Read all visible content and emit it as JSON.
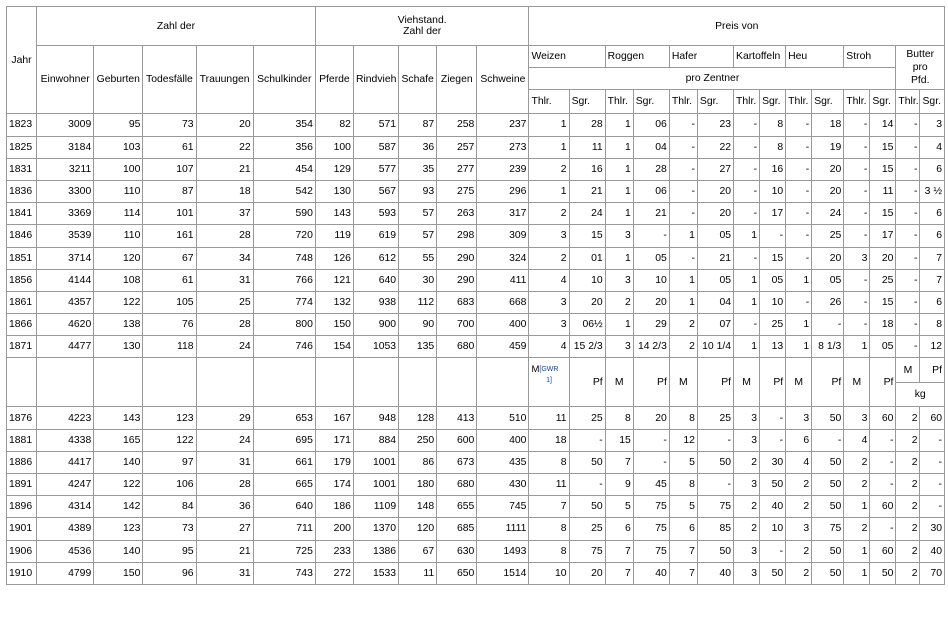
{
  "headers": {
    "jahr": "Jahr",
    "zahl_der": "Zahl der",
    "viehstand_line1": "Viehstand.",
    "viehstand_line2": "Zahl der",
    "preis_von": "Preis von",
    "pro_zentner": "pro Zentner",
    "butter_line1": "Butter",
    "butter_line2": "pro",
    "butter_line3": "Pfd.",
    "columns_population": [
      "Einwohner",
      "Geburten",
      "Todesfälle",
      "Trauungen",
      "Schulkinder"
    ],
    "columns_livestock": [
      "Pferde",
      "Rindvieh",
      "Schafe",
      "Ziegen",
      "Schweine"
    ],
    "goods": [
      "Weizen",
      "Roggen",
      "Hafer",
      "Kartoffeln",
      "Heu",
      "Stroh"
    ],
    "currency_old": [
      "Thlr.",
      "Sgr."
    ],
    "unit_kg": "kg"
  },
  "marker_row": {
    "m_label": "M",
    "m_sup": "[GWR",
    "m_sup_cont": "1]",
    "pf": "Pf",
    "m": "M"
  },
  "rows_old": [
    [
      "1823",
      "3009",
      "95",
      "73",
      "20",
      "354",
      "82",
      "571",
      "87",
      "258",
      "237",
      "1",
      "28",
      "1",
      "06",
      "-",
      "23",
      "-",
      "8",
      "-",
      "18",
      "-",
      "14",
      "-",
      "3"
    ],
    [
      "1825",
      "3184",
      "103",
      "61",
      "22",
      "356",
      "100",
      "587",
      "36",
      "257",
      "273",
      "1",
      "11",
      "1",
      "04",
      "-",
      "22",
      "-",
      "8",
      "-",
      "19",
      "-",
      "15",
      "-",
      "4"
    ],
    [
      "1831",
      "3211",
      "100",
      "107",
      "21",
      "454",
      "129",
      "577",
      "35",
      "277",
      "239",
      "2",
      "16",
      "1",
      "28",
      "-",
      "27",
      "-",
      "16",
      "-",
      "20",
      "-",
      "15",
      "-",
      "6"
    ],
    [
      "1836",
      "3300",
      "110",
      "87",
      "18",
      "542",
      "130",
      "567",
      "93",
      "275",
      "296",
      "1",
      "21",
      "1",
      "06",
      "-",
      "20",
      "-",
      "10",
      "-",
      "20",
      "-",
      "11",
      "-",
      "3 ½"
    ],
    [
      "1841",
      "3369",
      "114",
      "101",
      "37",
      "590",
      "143",
      "593",
      "57",
      "263",
      "317",
      "2",
      "24",
      "1",
      "21",
      "-",
      "20",
      "-",
      "17",
      "-",
      "24",
      "-",
      "15",
      "-",
      "6"
    ],
    [
      "1846",
      "3539",
      "110",
      "161",
      "28",
      "720",
      "119",
      "619",
      "57",
      "298",
      "309",
      "3",
      "15",
      "3",
      "-",
      "1",
      "05",
      "1",
      "-",
      "-",
      "25",
      "-",
      "17",
      "-",
      "6"
    ],
    [
      "1851",
      "3714",
      "120",
      "67",
      "34",
      "748",
      "126",
      "612",
      "55",
      "290",
      "324",
      "2",
      "01",
      "1",
      "05",
      "-",
      "21",
      "-",
      "15",
      "-",
      "20",
      "3",
      "20",
      "-",
      "7"
    ],
    [
      "1856",
      "4144",
      "108",
      "61",
      "31",
      "766",
      "121",
      "640",
      "30",
      "290",
      "411",
      "4",
      "10",
      "3",
      "10",
      "1",
      "05",
      "1",
      "05",
      "1",
      "05",
      "-",
      "25",
      "-",
      "7"
    ],
    [
      "1861",
      "4357",
      "122",
      "105",
      "25",
      "774",
      "132",
      "938",
      "112",
      "683",
      "668",
      "3",
      "20",
      "2",
      "20",
      "1",
      "04",
      "1",
      "10",
      "-",
      "26",
      "-",
      "15",
      "-",
      "6"
    ],
    [
      "1866",
      "4620",
      "138",
      "76",
      "28",
      "800",
      "150",
      "900",
      "90",
      "700",
      "400",
      "3",
      "06½",
      "1",
      "29",
      "2",
      "07",
      "-",
      "25",
      "1",
      "-",
      "-",
      "18",
      "-",
      "8"
    ],
    [
      "1871",
      "4477",
      "130",
      "118",
      "24",
      "746",
      "154",
      "1053",
      "135",
      "680",
      "459",
      "4",
      "15 2/3",
      "3",
      "14 2/3",
      "2",
      "10 1/4",
      "1",
      "13",
      "1",
      "8 1/3",
      "1",
      "05",
      "-",
      "12"
    ]
  ],
  "rows_new": [
    [
      "1876",
      "4223",
      "143",
      "123",
      "29",
      "653",
      "167",
      "948",
      "128",
      "413",
      "510",
      "11",
      "25",
      "8",
      "20",
      "8",
      "25",
      "3",
      "-",
      "3",
      "50",
      "3",
      "60",
      "2",
      "60"
    ],
    [
      "1881",
      "4338",
      "165",
      "122",
      "24",
      "695",
      "171",
      "884",
      "250",
      "600",
      "400",
      "18",
      "-",
      "15",
      "-",
      "12",
      "-",
      "3",
      "-",
      "6",
      "-",
      "4",
      "-",
      "2",
      "-"
    ],
    [
      "1886",
      "4417",
      "140",
      "97",
      "31",
      "661",
      "179",
      "1001",
      "86",
      "673",
      "435",
      "8",
      "50",
      "7",
      "-",
      "5",
      "50",
      "2",
      "30",
      "4",
      "50",
      "2",
      "-",
      "2",
      "-"
    ],
    [
      "1891",
      "4247",
      "122",
      "106",
      "28",
      "665",
      "174",
      "1001",
      "180",
      "680",
      "430",
      "11",
      "-",
      "9",
      "45",
      "8",
      "-",
      "3",
      "50",
      "2",
      "50",
      "2",
      "-",
      "2",
      "-"
    ],
    [
      "1896",
      "4314",
      "142",
      "84",
      "36",
      "640",
      "186",
      "1109",
      "148",
      "655",
      "745",
      "7",
      "50",
      "5",
      "75",
      "5",
      "75",
      "2",
      "40",
      "2",
      "50",
      "1",
      "60",
      "2",
      "-"
    ],
    [
      "1901",
      "4389",
      "123",
      "73",
      "27",
      "711",
      "200",
      "1370",
      "120",
      "685",
      "1111",
      "8",
      "25",
      "6",
      "75",
      "6",
      "85",
      "2",
      "10",
      "3",
      "75",
      "2",
      "-",
      "2",
      "30"
    ],
    [
      "1906",
      "4536",
      "140",
      "95",
      "21",
      "725",
      "233",
      "1386",
      "67",
      "630",
      "1493",
      "8",
      "75",
      "7",
      "75",
      "7",
      "50",
      "3",
      "-",
      "2",
      "50",
      "1",
      "60",
      "2",
      "40"
    ],
    [
      "1910",
      "4799",
      "150",
      "96",
      "31",
      "743",
      "272",
      "1533",
      "11",
      "650",
      "1514",
      "10",
      "20",
      "7",
      "40",
      "7",
      "40",
      "3",
      "50",
      "2",
      "50",
      "1",
      "50",
      "2",
      "70"
    ]
  ]
}
